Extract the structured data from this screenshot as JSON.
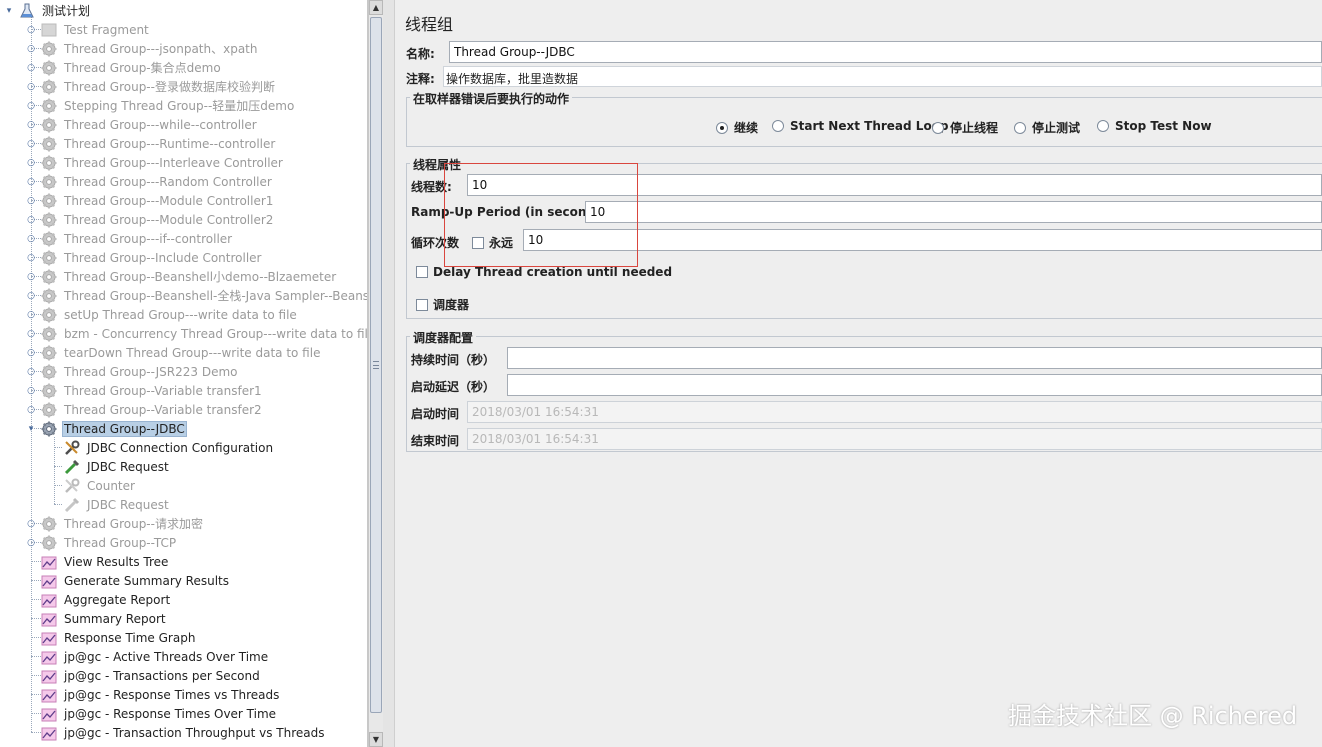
{
  "tree": {
    "root": "测试计划",
    "items": [
      {
        "label": "Test Fragment",
        "icon": "fragment-icon",
        "disabled": true
      },
      {
        "label": "Thread Group---jsonpath、xpath",
        "icon": "gear-icon",
        "disabled": true
      },
      {
        "label": "Thread Group-集合点demo",
        "icon": "gear-icon",
        "disabled": true
      },
      {
        "label": "Thread Group--登录做数据库校验判断",
        "icon": "gear-icon",
        "disabled": true
      },
      {
        "label": "Stepping Thread Group--轻量加压demo",
        "icon": "gear-icon",
        "disabled": true
      },
      {
        "label": "Thread Group---while--controller",
        "icon": "gear-icon",
        "disabled": true
      },
      {
        "label": "Thread Group---Runtime--controller",
        "icon": "gear-icon",
        "disabled": true
      },
      {
        "label": "Thread Group---Interleave Controller",
        "icon": "gear-icon",
        "disabled": true
      },
      {
        "label": "Thread Group---Random Controller",
        "icon": "gear-icon",
        "disabled": true
      },
      {
        "label": "Thread Group---Module Controller1",
        "icon": "gear-icon",
        "disabled": true
      },
      {
        "label": "Thread Group---Module Controller2",
        "icon": "gear-icon",
        "disabled": true
      },
      {
        "label": "Thread Group---if--controller",
        "icon": "gear-icon",
        "disabled": true
      },
      {
        "label": "Thread Group--Include Controller",
        "icon": "gear-icon",
        "disabled": true
      },
      {
        "label": "Thread Group--Beanshell小demo--Blzaemeter",
        "icon": "gear-icon",
        "disabled": true
      },
      {
        "label": "Thread Group--Beanshell-全栈-Java Sampler--Beanshe",
        "icon": "gear-icon",
        "disabled": true
      },
      {
        "label": "setUp Thread Group---write data to file",
        "icon": "gear-icon",
        "disabled": true
      },
      {
        "label": "bzm - Concurrency Thread Group---write data to file",
        "icon": "gear-icon",
        "disabled": true
      },
      {
        "label": "tearDown Thread Group---write data to file",
        "icon": "gear-icon",
        "disabled": true
      },
      {
        "label": "Thread Group--JSR223 Demo",
        "icon": "gear-icon",
        "disabled": true
      },
      {
        "label": "Thread Group--Variable transfer1",
        "icon": "gear-icon",
        "disabled": true
      },
      {
        "label": "Thread Group--Variable transfer2",
        "icon": "gear-icon",
        "disabled": true
      },
      {
        "label": "Thread Group--JDBC",
        "icon": "gear-icon",
        "disabled": false,
        "selected": true,
        "expanded": true
      },
      {
        "label": "JDBC Connection Configuration",
        "icon": "wrench-icon",
        "disabled": false,
        "child": true
      },
      {
        "label": "JDBC Request",
        "icon": "pipette-icon",
        "disabled": false,
        "child": true
      },
      {
        "label": "Counter",
        "icon": "wrench-icon",
        "disabled": true,
        "child": true
      },
      {
        "label": "JDBC Request",
        "icon": "pipette-icon",
        "disabled": true,
        "child": true
      },
      {
        "label": "Thread Group--请求加密",
        "icon": "gear-icon",
        "disabled": true
      },
      {
        "label": "Thread Group--TCP",
        "icon": "gear-icon",
        "disabled": true
      },
      {
        "label": "View Results Tree",
        "icon": "graph-icon",
        "disabled": false,
        "leaf": true
      },
      {
        "label": "Generate Summary Results",
        "icon": "graph-icon",
        "disabled": false,
        "leaf": true
      },
      {
        "label": "Aggregate Report",
        "icon": "graph-icon",
        "disabled": false,
        "leaf": true
      },
      {
        "label": "Summary Report",
        "icon": "graph-icon",
        "disabled": false,
        "leaf": true
      },
      {
        "label": "Response Time Graph",
        "icon": "graph-icon",
        "disabled": false,
        "leaf": true
      },
      {
        "label": "jp@gc - Active Threads Over Time",
        "icon": "graph-icon",
        "disabled": false,
        "leaf": true
      },
      {
        "label": "jp@gc - Transactions per Second",
        "icon": "graph-icon",
        "disabled": false,
        "leaf": true
      },
      {
        "label": "jp@gc - Response Times vs Threads",
        "icon": "graph-icon",
        "disabled": false,
        "leaf": true
      },
      {
        "label": "jp@gc - Response Times Over Time",
        "icon": "graph-icon",
        "disabled": false,
        "leaf": true
      },
      {
        "label": "jp@gc - Transaction Throughput vs Threads",
        "icon": "graph-icon",
        "disabled": false,
        "leaf": true
      }
    ]
  },
  "panel": {
    "title": "线程组",
    "name_label": "名称:",
    "name_value": "Thread Group--JDBC",
    "comment_label": "注释:",
    "comment_value": "操作数据库，批里造数据",
    "error_action": {
      "title": "在取样器错误后要执行的动作",
      "options": [
        "继续",
        "Start Next Thread Loop",
        "停止线程",
        "停止测试",
        "Stop Test Now"
      ],
      "selected": 0
    },
    "thread_props": {
      "title": "线程属性",
      "threads_label": "线程数:",
      "threads_value": "10",
      "rampup_label": "Ramp-Up Period (in seconds):",
      "rampup_value": "10",
      "loop_label": "循环次数",
      "forever_label": "永远",
      "loop_value": "10",
      "delay_label": "Delay Thread creation until needed",
      "scheduler_label": "调度器"
    },
    "scheduler": {
      "title": "调度器配置",
      "duration_label": "持续时间（秒）",
      "delay_label": "启动延迟（秒）",
      "start_label": "启动时间",
      "start_value": "2018/03/01 16:54:31",
      "end_label": "结束时间",
      "end_value": "2018/03/01 16:54:31"
    }
  },
  "watermark": "掘金技术社区 @ Richered",
  "colors": {
    "selection": "#b8cfe5",
    "highlight_box": "#d9463e"
  }
}
